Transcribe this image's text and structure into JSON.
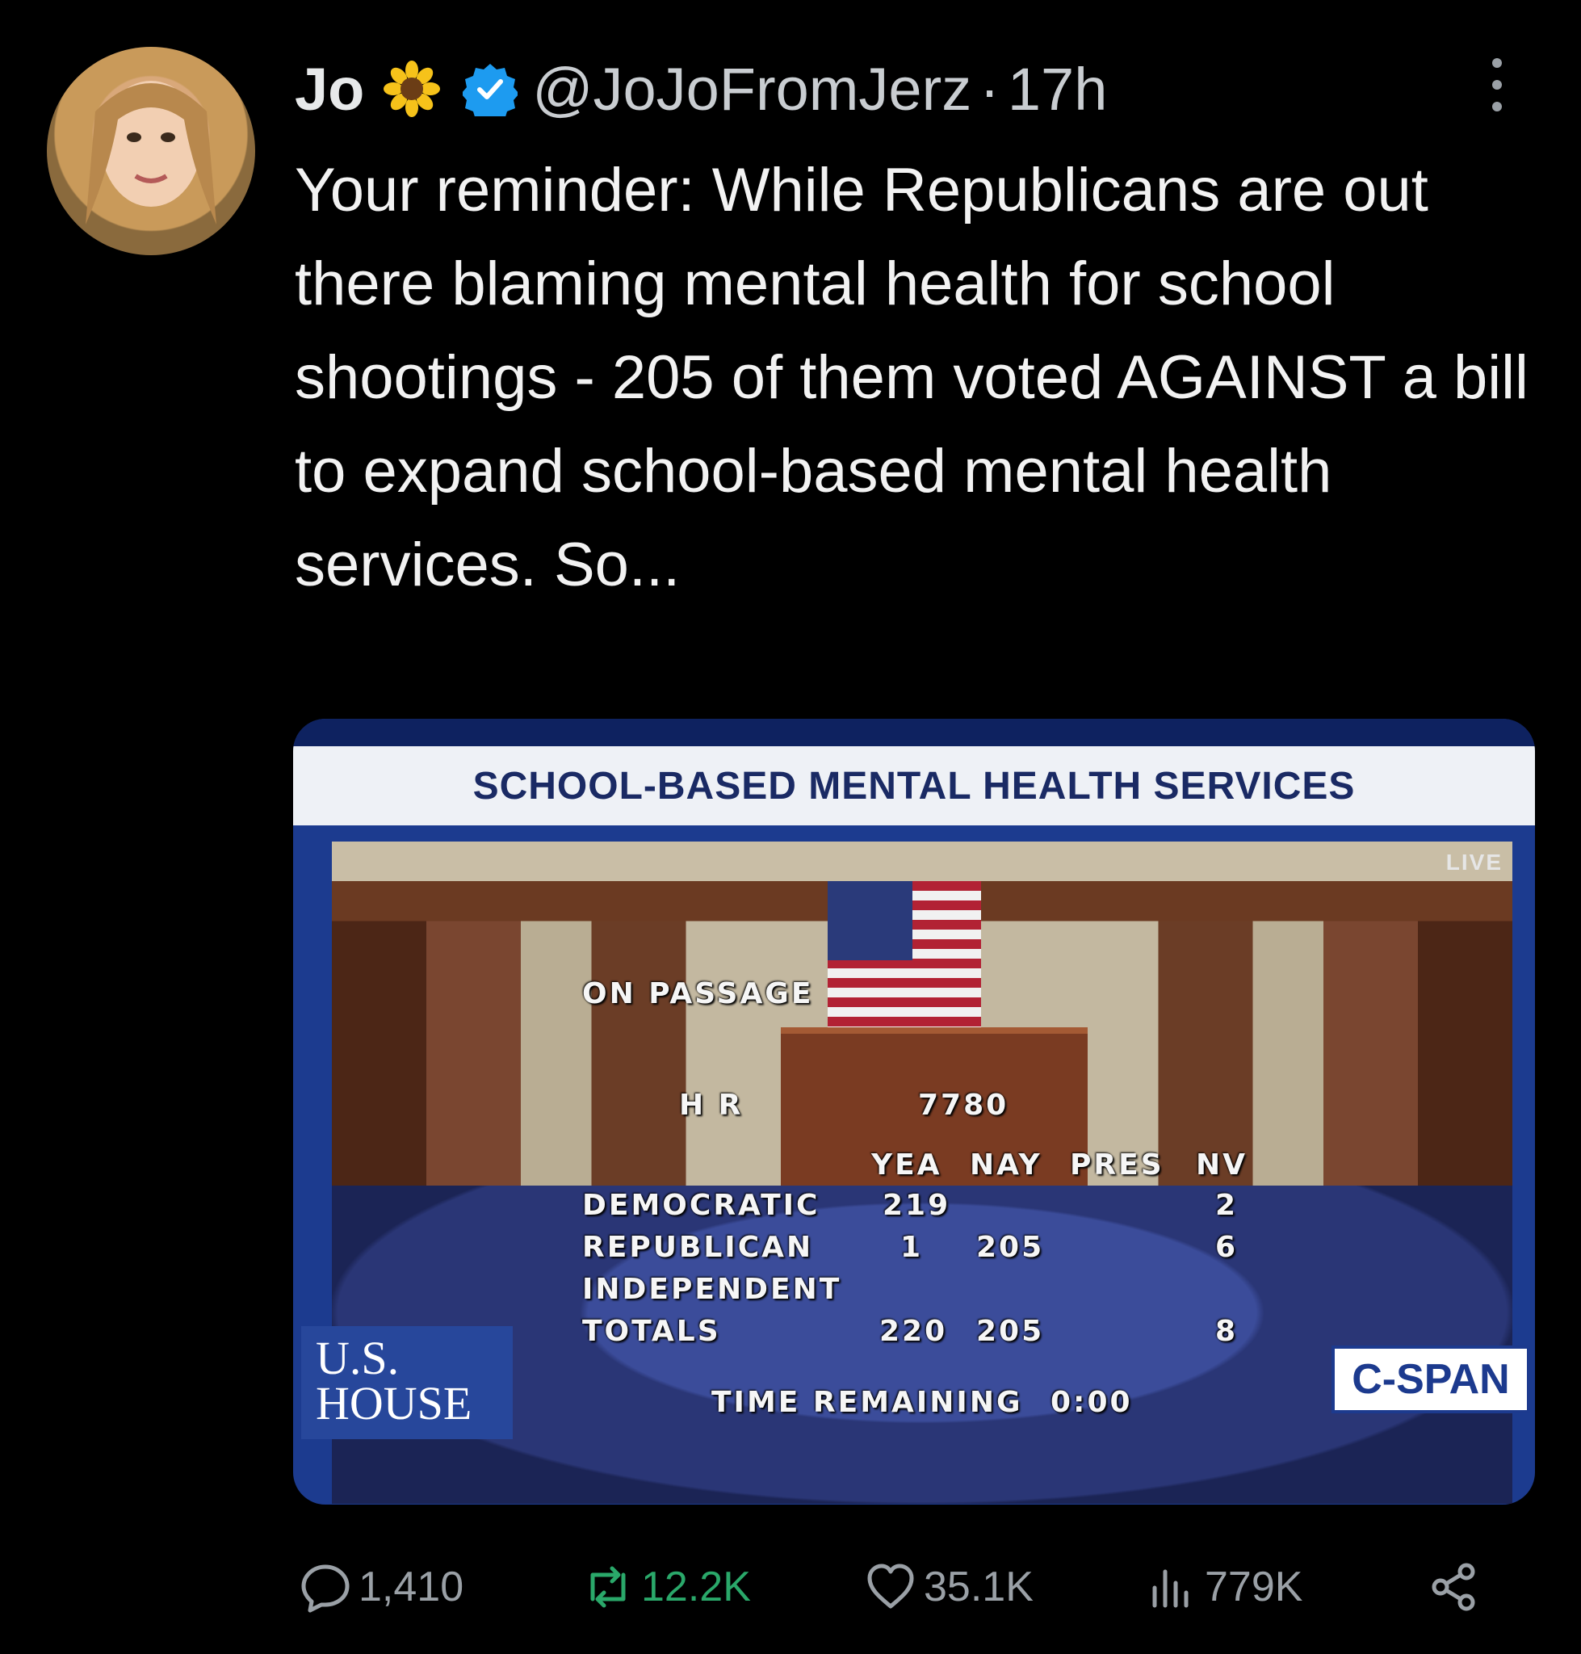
{
  "tweet": {
    "author_name": "Jo",
    "author_emoji": "🌻",
    "handle": "@JoJoFromJerz",
    "separator": "·",
    "time": "17h",
    "text": "Your reminder: While Republicans are out there blaming mental health for school shootings - 205 of them voted AGAINST a bill to expand school-based mental health services. So..."
  },
  "media": {
    "banner": "SCHOOL-BASED MENTAL HEALTH SERVICES",
    "live": "LIVE",
    "vote": {
      "on_passage": "ON PASSAGE",
      "bill_prefix": "H R",
      "bill_number": "7780",
      "columns": [
        "YEA",
        "NAY",
        "PRES",
        "NV"
      ],
      "rows": [
        {
          "party": "DEMOCRATIC",
          "yea": "219",
          "nay": "",
          "pres": "",
          "nv": "2"
        },
        {
          "party": "REPUBLICAN",
          "yea": "1",
          "nay": "205",
          "pres": "",
          "nv": "6"
        },
        {
          "party": "INDEPENDENT",
          "yea": "",
          "nay": "",
          "pres": "",
          "nv": ""
        },
        {
          "party": "TOTALS",
          "yea": "220",
          "nay": "205",
          "pres": "",
          "nv": "8"
        }
      ],
      "time_remaining_label": "TIME REMAINING",
      "time_remaining": "0:00"
    },
    "logo_left_line1": "U.S.",
    "logo_left_line2": "HOUSE",
    "logo_right": "C-SPAN"
  },
  "actions": {
    "replies": "1,410",
    "retweets": "12.2K",
    "likes": "35.1K",
    "views": "779K"
  },
  "colors": {
    "background": "#000000",
    "text": "#e7e9ea",
    "muted": "#9aa0a6",
    "verified": "#1d9bf0",
    "retweet": "#2aa86a"
  }
}
